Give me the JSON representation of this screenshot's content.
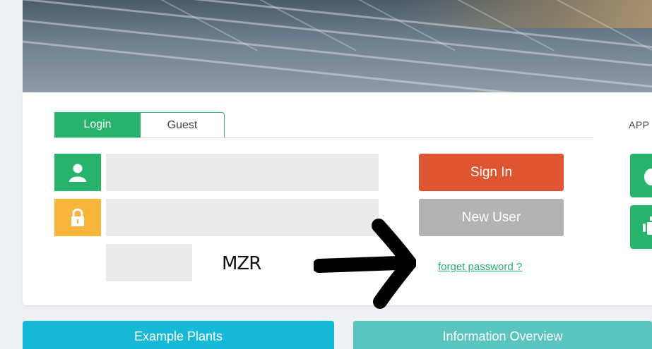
{
  "tabs": [
    {
      "label": "Login"
    },
    {
      "label": "Guest"
    }
  ],
  "app_section": {
    "label": "APP"
  },
  "icons": {
    "username": "user-icon",
    "password": "lock-icon",
    "app_ios": "apple-icon",
    "app_android": "android-icon"
  },
  "form": {
    "username_value": "",
    "password_value": "",
    "captcha_value": "",
    "captcha_text": "MZR"
  },
  "buttons": {
    "sign_in": "Sign In",
    "new_user": "New User"
  },
  "links": {
    "forget_password": "forget password ?"
  },
  "bottom_cards": [
    {
      "label": "Example Plants"
    },
    {
      "label": "Information Overview"
    }
  ],
  "colors": {
    "accent_green": "#27b36b",
    "sign_in_orange": "#de5631",
    "new_user_gray": "#b3b3b3",
    "password_icon_yellow": "#f7b53b",
    "example_cyan": "#18b9d7",
    "info_teal": "#5ac4be"
  }
}
